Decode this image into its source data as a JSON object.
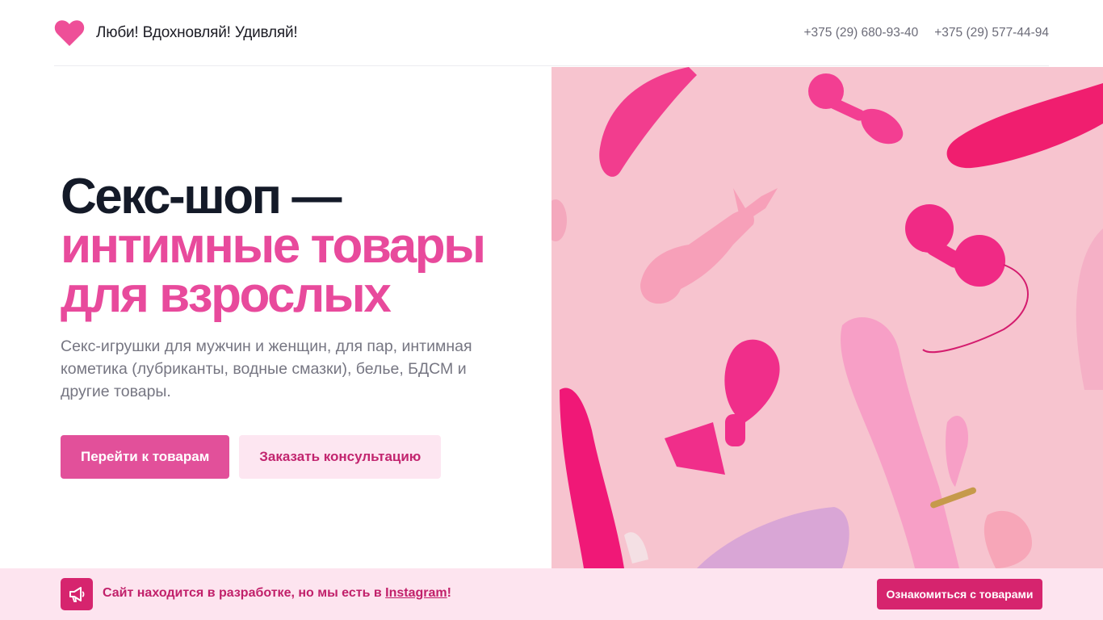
{
  "header": {
    "brand_name": "Люби! Вдохновляй! Удивляй!",
    "logo_icon": "heart-icon",
    "phones": [
      "+375 (29) 680-93-40",
      "+375 (29) 577-44-94"
    ]
  },
  "hero": {
    "title_dark": "Секс-шоп —",
    "title_pink_line1": "интимные товары",
    "title_pink_line2": "для взрослых",
    "subtitle": "Секс-игрушки для мужчин и женщин, для пар, интимная кометика (лубриканты, водные смазки), белье, БДСМ и другие товары.",
    "primary_button": "Перейти к товарам",
    "secondary_button": "Заказать консультацию",
    "image_icon": "product-photo"
  },
  "banner": {
    "icon": "megaphone-icon",
    "text_before": "Сайт находится в разработке, но мы есть в ",
    "link_text": "Instagram",
    "text_after": "!",
    "button": "Ознакомиться с товарами"
  },
  "colors": {
    "accent": "#e2509a",
    "accent_dark": "#d6246e",
    "banner_bg": "#fde4ef",
    "heading_dark": "#141a28"
  }
}
